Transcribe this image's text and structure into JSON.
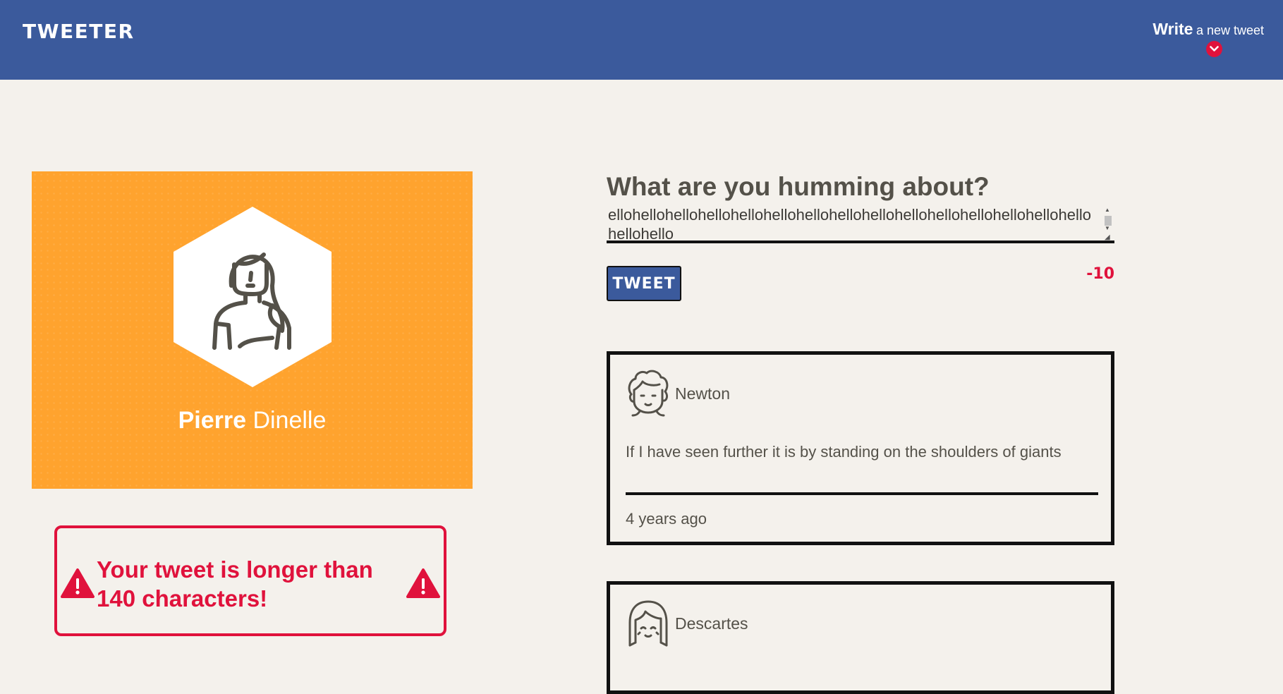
{
  "nav": {
    "logo": "TWEETER",
    "compose_bold": "Write",
    "compose_rest": "a new tweet",
    "compose_icon": "chevron-down-icon"
  },
  "profile": {
    "first_name": "Pierre",
    "last_name": "Dinelle",
    "avatar_icon": "woman-avatar-icon"
  },
  "error": {
    "message": "Your tweet is longer than 140 characters!",
    "icon": "warning-icon"
  },
  "compose": {
    "title": "What are you humming about?",
    "textarea_value": "ellohellohellohellohellohellohellohellohellohellohellohellohellohellohellohellohello",
    "button_label": "TWEET",
    "counter": "-10"
  },
  "tweets": [
    {
      "author": "Newton",
      "avatar_icon": "curly-hair-avatar-icon",
      "content": "If I have seen further it is by standing on the shoulders of giants",
      "time": "4 years ago"
    },
    {
      "author": "Descartes",
      "avatar_icon": "bob-hair-avatar-icon"
    }
  ],
  "colors": {
    "nav": "#3b5a9c",
    "profile_card": "#ffa32e",
    "error": "#e0123c",
    "background": "#f4f1ec"
  }
}
